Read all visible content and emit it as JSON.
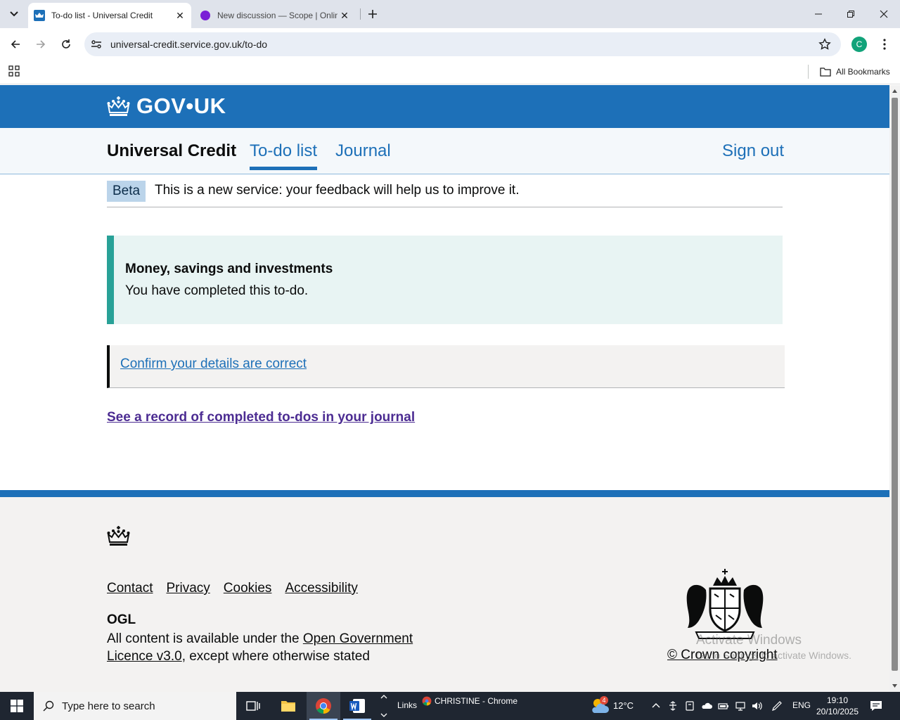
{
  "browser": {
    "tabs": [
      {
        "title": "To-do list - Universal Credit",
        "active": true,
        "favicon": "gov-crown-icon"
      },
      {
        "title": "New discussion — Scope | Online",
        "active": false,
        "favicon": "scope-icon"
      }
    ],
    "url": "universal-credit.service.gov.uk/to-do",
    "profile_initial": "C",
    "bookmarks_label": "All Bookmarks"
  },
  "page": {
    "logo_text": "GOV•UK",
    "service_name": "Universal Credit",
    "nav": {
      "todo": "To-do list",
      "journal": "Journal",
      "signout": "Sign out"
    },
    "phase": {
      "tag": "Beta",
      "text": "This is a new service: your feedback will help us to improve it."
    },
    "panel": {
      "heading": "Money, savings and investments",
      "body": "You have completed this to-do."
    },
    "todo_link": "Confirm your details are correct",
    "journal_link": "See a record of completed to-dos in your journal",
    "footer": {
      "links": [
        "Contact",
        "Privacy",
        "Cookies",
        "Accessibility"
      ],
      "ogl": "OGL",
      "licence_prefix": "All content is available under the ",
      "licence_link": "Open Government Licence v3.0",
      "licence_suffix": ", except where otherwise stated",
      "copyright": "© Crown copyright"
    },
    "watermark": {
      "title": "Activate Windows",
      "sub": "Go to Settings to activate Windows."
    }
  },
  "taskbar": {
    "search_placeholder": "Type here to search",
    "links_label": "Links",
    "chrome_label": "CHRISTINE - Chrome",
    "weather_badge": "4",
    "temperature": "12°C",
    "language": "ENG",
    "time": "19:10",
    "date": "20/10/2025"
  },
  "colors": {
    "gov_blue": "#1d70b8",
    "panel_green": "#28a197",
    "visited_purple": "#4c2c92"
  }
}
